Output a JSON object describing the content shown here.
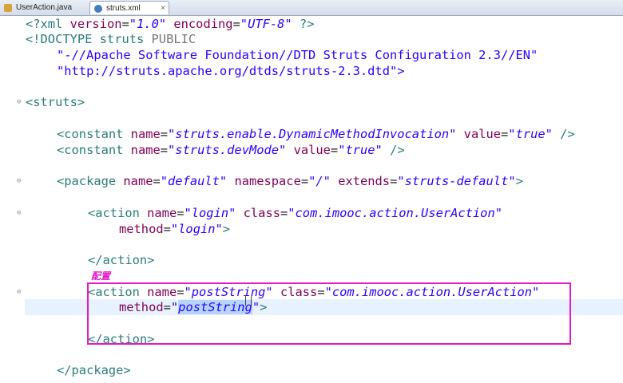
{
  "tabs": [
    {
      "label": "UserAction.java",
      "active": false
    },
    {
      "label": "struts.xml",
      "active": true,
      "close": "×"
    }
  ],
  "code": {
    "l1": {
      "a": "<?xml ",
      "b": "version",
      "c": "=",
      "d": "\"1.0\"",
      "e": " encoding",
      "f": "=",
      "g": "\"UTF-8\"",
      "h": " ?>"
    },
    "l2": {
      "a": "<!DOCTYPE struts ",
      "b": "PUBLIC"
    },
    "l3": {
      "a": "\"-//Apache Software Foundation//DTD Struts Configuration 2.3//EN\""
    },
    "l4": {
      "a": "\"http://struts.apache.org/dtds/struts-2.3.dtd\">"
    },
    "l5": {
      "a": "<struts>"
    },
    "l6": {
      "a": "<constant ",
      "b": "name",
      "c": "=",
      "d": "\"struts.enable.DynamicMethodInvocation\"",
      "e": " value",
      "f": "=",
      "g": "\"true\"",
      "h": " />"
    },
    "l7": {
      "a": "<constant ",
      "b": "name",
      "c": "=",
      "d": "\"struts.devMode\"",
      "e": " value",
      "f": "=",
      "g": "\"true\"",
      "h": " />"
    },
    "l8": {
      "a": "<package ",
      "b": "name",
      "c": "=",
      "d": "\"default\"",
      "e": " namespace",
      "f": "=",
      "g": "\"/\"",
      "h": " extends",
      "i": "=",
      "j": "\"struts-default\"",
      "k": ">"
    },
    "l9": {
      "a": "<action ",
      "b": "name",
      "c": "=",
      "d": "\"login\"",
      "e": " class",
      "f": "=",
      "g": "\"com.imooc.action.UserAction\""
    },
    "l10": {
      "a": "method",
      "b": "=",
      "c": "\"login\"",
      "d": ">"
    },
    "l11": {
      "a": "</action>"
    },
    "l12": {
      "a": "<action ",
      "b": "name",
      "c": "=",
      "d": "\"postString\"",
      "e": " class",
      "f": "=",
      "g": "\"com.imooc.action.UserAction\""
    },
    "l13": {
      "a": "method",
      "b": "=",
      "c": "\"",
      "d": "postString",
      "e": "\"",
      "f": ">"
    },
    "l14": {
      "a": "</action>"
    },
    "l15": {
      "a": "</package>"
    }
  },
  "annotation": {
    "text": "配置",
    "color": "#e21bc9"
  },
  "colors": {
    "tag": "#2c7a7a",
    "attr": "#7f0055",
    "value": "#2a00ff",
    "highlight": "#e21bc9"
  }
}
